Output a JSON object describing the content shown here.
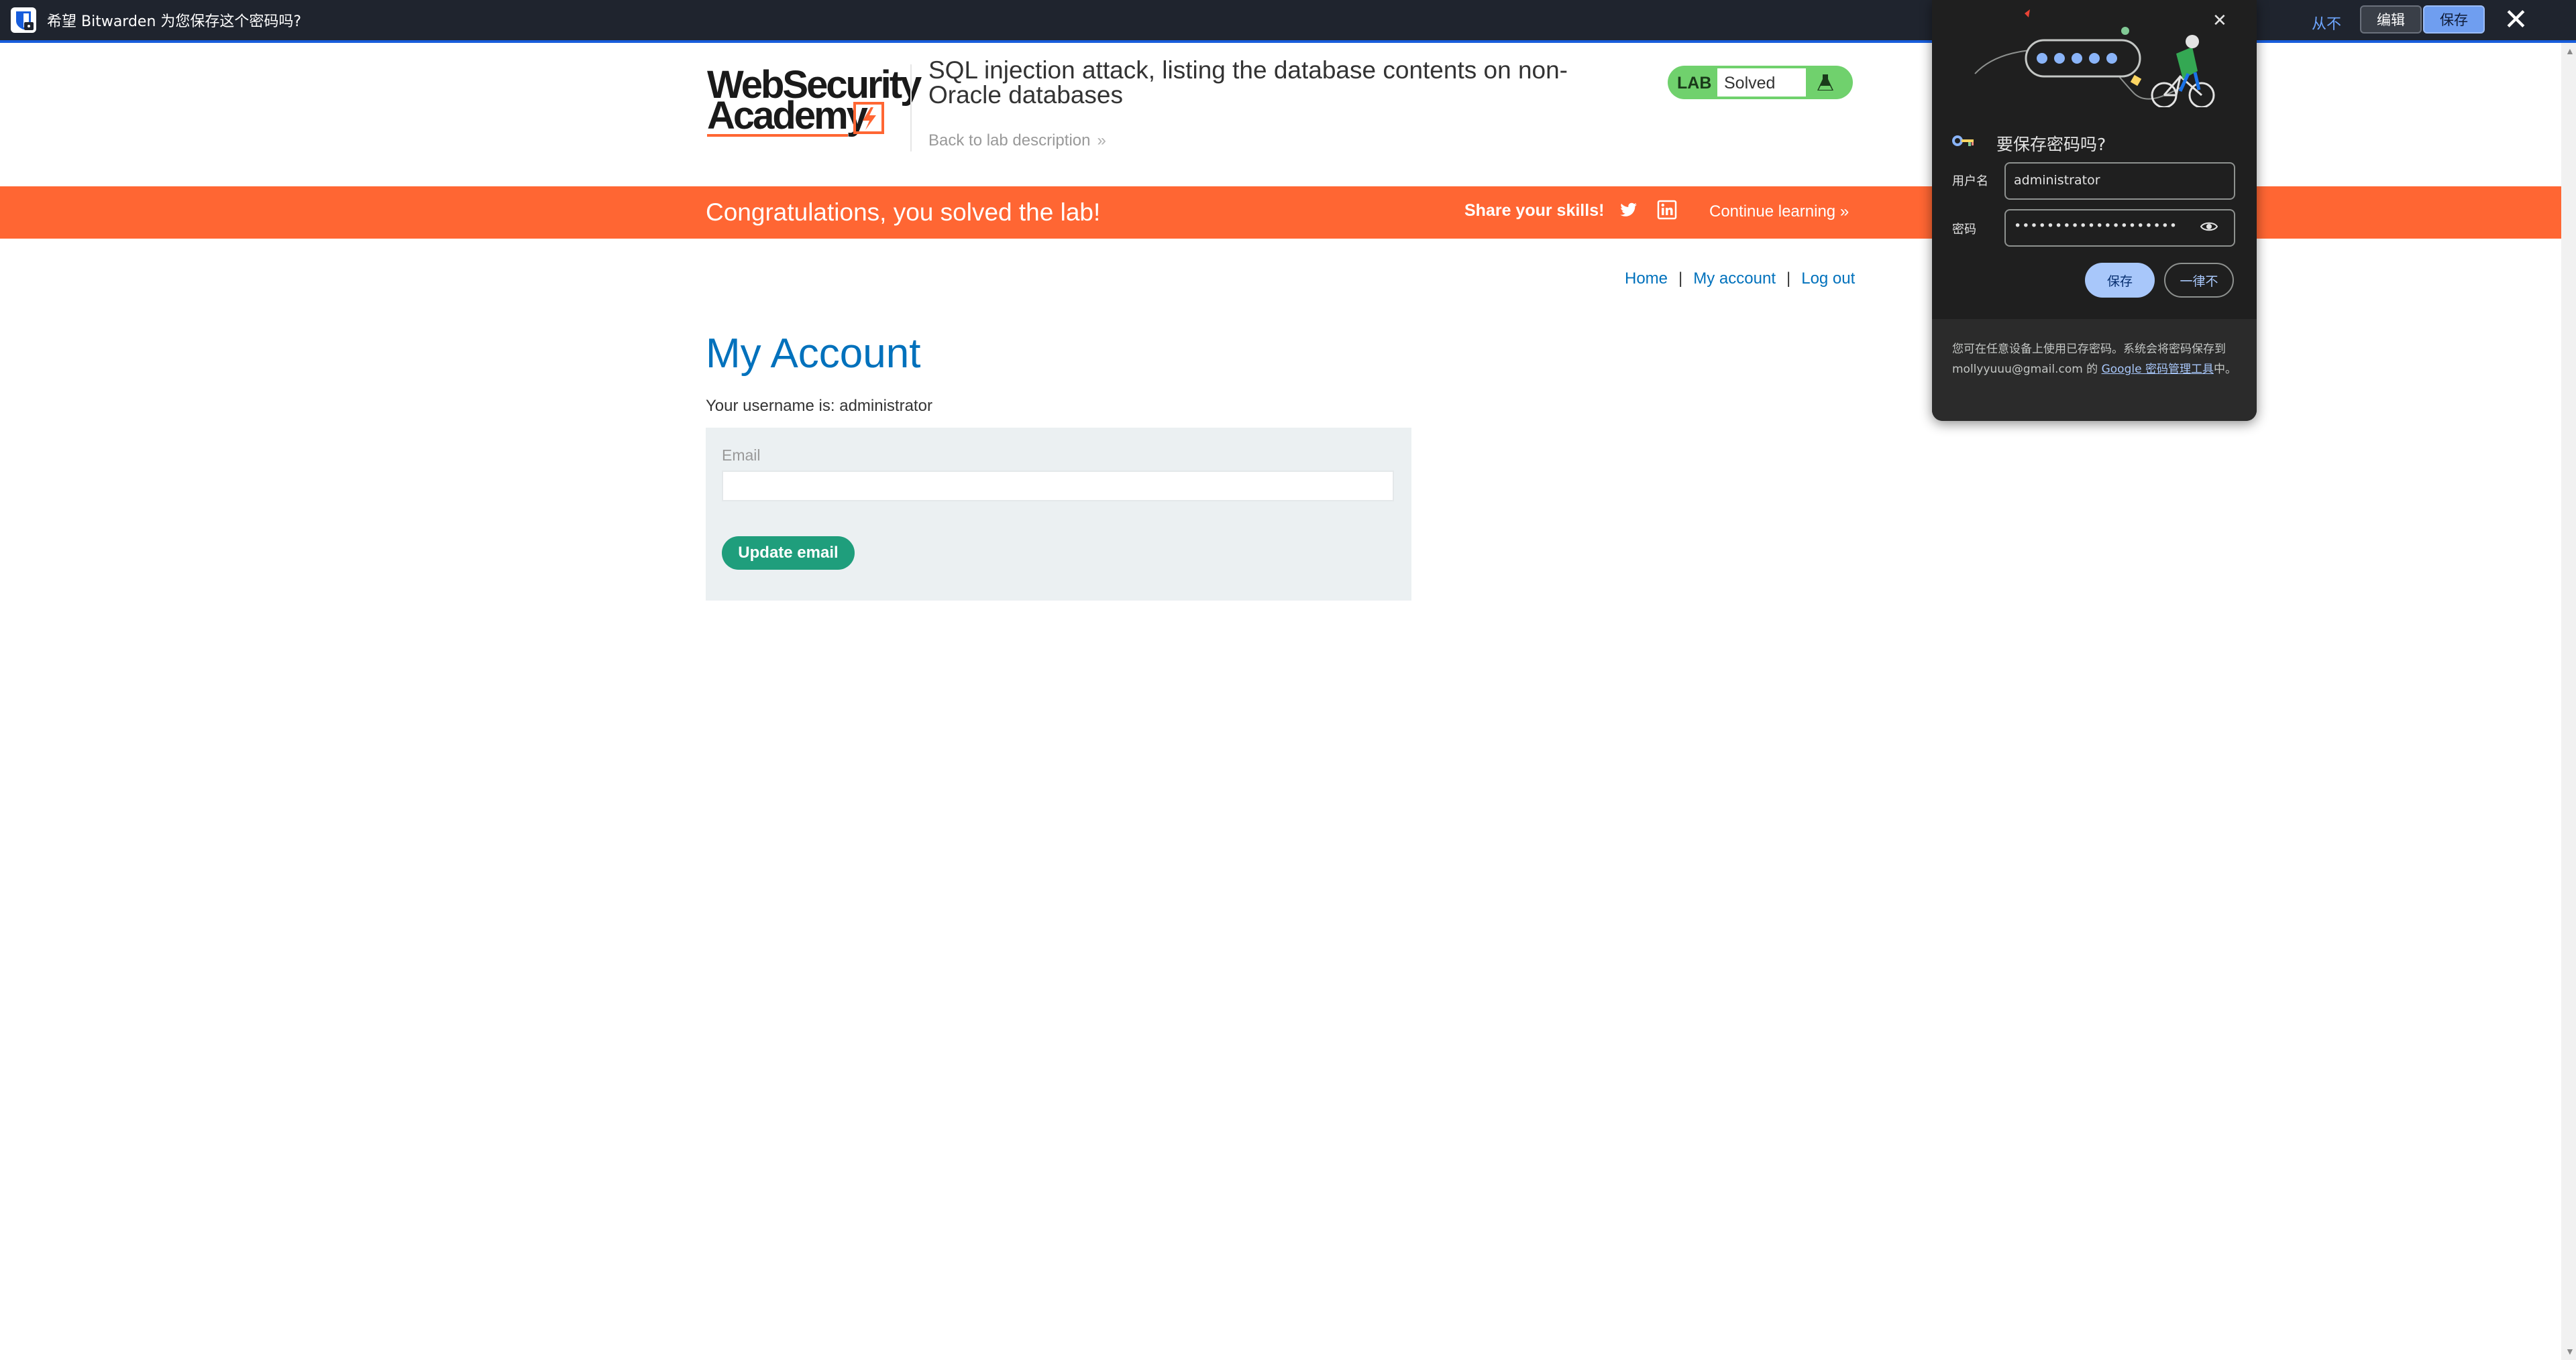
{
  "bitwarden_bar": {
    "message": "希望 Bitwarden 为您保存这个密码吗?",
    "never_label": "从不",
    "edit_label": "编辑",
    "save_label": "保存",
    "close_symbol": "✕",
    "accent_color": "#175ddc"
  },
  "lab_header": {
    "logo_line1": "WebSecurity",
    "logo_line2": "Academy",
    "title": "SQL injection attack, listing the database contents on non-Oracle databases",
    "back_link": "Back to lab description",
    "badge_label": "LAB",
    "badge_status": "Solved",
    "badge_color": "#70d16d"
  },
  "banner": {
    "message": "Congratulations, you solved the lab!",
    "share_label": "Share your skills!",
    "continue_label": "Continue learning",
    "icons": [
      "twitter-icon",
      "linkedin-icon"
    ],
    "color": "#ff6633"
  },
  "nav": {
    "home": "Home",
    "my_account": "My account",
    "log_out": "Log out",
    "separator": "|"
  },
  "account": {
    "title": "My Account",
    "username_line": "Your username is: administrator",
    "email_label": "Email",
    "email_value": "",
    "update_button": "Update email"
  },
  "password_popup": {
    "title": "要保存密码吗?",
    "username_label": "用户名",
    "username_value": "administrator",
    "password_label": "密码",
    "password_value": "••••••••••••••••••••",
    "save_label": "保存",
    "never_label": "一律不",
    "close_symbol": "✕",
    "footer_text": "您可在任意设备上使用已存密码。系统会将密码保存到 mollyyuuu@gmail.com 的 ",
    "footer_link": "Google 密码管理工具",
    "footer_end": "中。"
  }
}
